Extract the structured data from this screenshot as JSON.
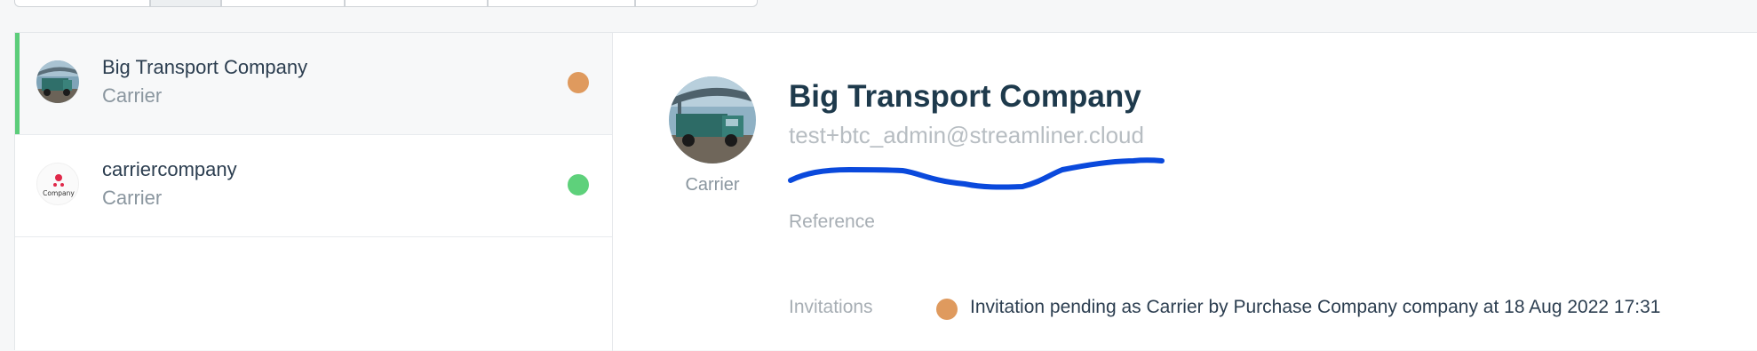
{
  "list": {
    "items": [
      {
        "name": "Big Transport Company",
        "role": "Carrier",
        "status_color": "#df9a5e",
        "avatar_icon": "truck-photo-icon"
      },
      {
        "name": "carriercompany",
        "role": "Carrier",
        "status_color": "#5ed17b",
        "avatar_icon": "company-logo-icon",
        "logo_text": "Company"
      }
    ]
  },
  "detail": {
    "name": "Big Transport Company",
    "email": "test+btc_admin@streamliner.cloud",
    "avatar_caption": "Carrier",
    "reference_label": "Reference",
    "invitations_label": "Invitations",
    "invitation": {
      "status_color": "#df9a5e",
      "text": "Invitation pending as Carrier by Purchase Company company at 18 Aug 2022 17:31"
    }
  },
  "colors": {
    "selected_accent": "#5ccd7a",
    "scribble": "#0a49dc"
  }
}
